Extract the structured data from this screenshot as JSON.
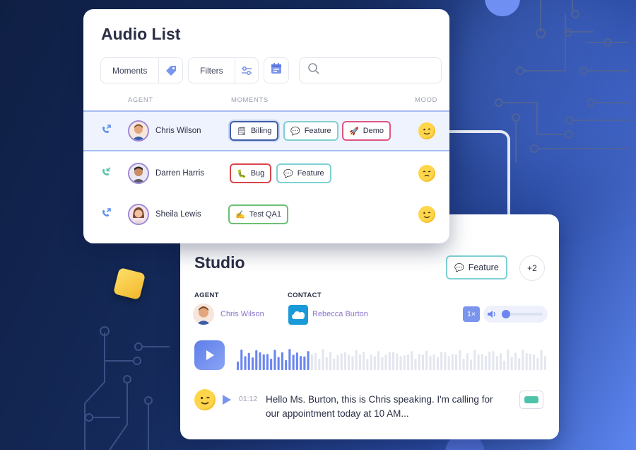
{
  "audio_list": {
    "title": "Audio List",
    "toolbar": {
      "moments_label": "Moments",
      "filters_label": "Filters",
      "search_placeholder": ""
    },
    "columns": {
      "agent": "AGENT",
      "moments": "MOMENTS",
      "mood": "MOOD"
    },
    "rows": [
      {
        "agent": "Chris Wilson",
        "direction": "outgoing",
        "mood": "happy",
        "tags": [
          {
            "label": "Billing",
            "icon": "document-icon",
            "color": "#3f5fa8"
          },
          {
            "label": "Feature",
            "icon": "chat-icon",
            "color": "#7fd0d4"
          },
          {
            "label": "Demo",
            "icon": "rocket-icon",
            "color": "#e05384"
          }
        ]
      },
      {
        "agent": "Darren Harris",
        "direction": "incoming",
        "mood": "sad",
        "tags": [
          {
            "label": "Bug",
            "icon": "bug-icon",
            "color": "#d9454a"
          },
          {
            "label": "Feature",
            "icon": "chat-icon",
            "color": "#7fd0d4"
          }
        ]
      },
      {
        "agent": "Sheila Lewis",
        "direction": "outgoing",
        "mood": "happy",
        "tags": [
          {
            "label": "Test QA1",
            "icon": "pencil-icon",
            "color": "#6cbf72"
          }
        ]
      }
    ]
  },
  "studio": {
    "title": "Studio",
    "tag": {
      "label": "Feature",
      "icon": "chat-icon"
    },
    "more_count": "+2",
    "agent_label": "AGENT",
    "agent_name": "Chris Wilson",
    "contact_label": "CONTACT",
    "contact_name": "Rebecca Burton",
    "speed": "1×",
    "playback_progress": 0.23,
    "timestamp": "01:12",
    "transcript": "Hello Ms. Burton, this is Chris speaking. I'm calling for our appointment today at 10 AM...",
    "colors": {
      "accent": "#6b86f0",
      "teal": "#4fc3a9"
    }
  }
}
